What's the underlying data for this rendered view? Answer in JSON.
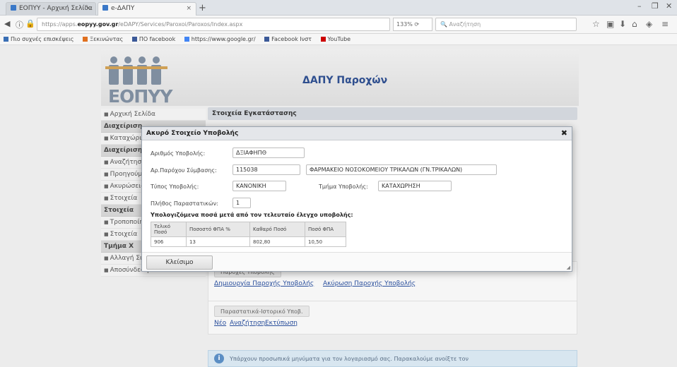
{
  "browser": {
    "tabs": [
      {
        "title": "ΕΟΠΥΥ - Αρχική Σελίδα"
      },
      {
        "title": "e-ΔΑΠΥ"
      }
    ],
    "address": {
      "prefix": "https://apps.",
      "domain": "eopyy.gov.gr",
      "path": "/eDAPY/Services/Paroxoi/Paroxos/Index.aspx"
    },
    "zoom": "133%",
    "search_placeholder": "Αναζήτηση",
    "bookmarks": [
      {
        "label": "Πιο συχνές επισκέψεις",
        "color": "#3a6fb5"
      },
      {
        "label": "Ξεκινώντας",
        "color": "#e07020"
      },
      {
        "label": "ΠΟ facebook",
        "color": "#3b5998"
      },
      {
        "label": "https://www.google.gr/",
        "color": "#4285f4"
      },
      {
        "label": "Facebook Ινστ",
        "color": "#3b5998"
      },
      {
        "label": "YouTube",
        "color": "#cc0000"
      }
    ]
  },
  "header": {
    "logo": "ΕΟΠΥΥ",
    "title": "ΔΑΠΥ Παροχών"
  },
  "sidebar": {
    "items": [
      {
        "kind": "item",
        "label": "Αρχική Σελίδα"
      },
      {
        "kind": "head",
        "label": "Διαχείριση"
      },
      {
        "kind": "item",
        "label": "Καταχώριση"
      },
      {
        "kind": "head",
        "label": "Διαχείριση"
      },
      {
        "kind": "item",
        "label": "Αναζήτηση"
      },
      {
        "kind": "item",
        "label": "Προηγούμενα"
      },
      {
        "kind": "item",
        "label": "Ακυρώσεις"
      },
      {
        "kind": "item",
        "label": "Στοιχεία"
      },
      {
        "kind": "head",
        "label": "Στοιχεία"
      },
      {
        "kind": "item",
        "label": "Τροποποίηση"
      },
      {
        "kind": "item",
        "label": "Στοιχεία"
      },
      {
        "kind": "head",
        "label": "Τμήμα Χ"
      },
      {
        "kind": "item",
        "label": "Αλλαγή Συνθηματικού"
      },
      {
        "kind": "item",
        "label": "Αποσύνδεση"
      }
    ]
  },
  "content": {
    "section_title": "Στοιχεία Εγκατάστασης",
    "pill_submissions": "Παροχές Υποβολής",
    "link_create": "Δημιουργία Παροχής Υποβολής",
    "link_cancel": "Ακύρωση Παροχής Υποβολής",
    "pill_history": "Παραστατικά-Ιστορικό Υποβ.",
    "link_new": "Νέο",
    "link_search": "Αναζήτηση",
    "link_print": "Εκτύπωση",
    "info_text": "Υπάρχουν προσωπικά μηνύματα για τον λογαριασμό σας. Παρακαλούμε ανοίξτε τον"
  },
  "modal": {
    "title": "Ακυρό Στοιχείο Υποβολής",
    "close_glyph": "✖",
    "fields": {
      "submission_no_label": "Αριθμός Υποβολής:",
      "submission_no": "ΔΞΙΑΦΗΠΘ",
      "provider_code_label": "Αρ.Παρόχου Σύμβασης:",
      "provider_code": "115038",
      "provider_name": "ΦΑΡΜΑΚΕΙΟ ΝΟΣΟΚΟΜΕΙΟΥ ΤΡΙΚΑΛΩΝ (ΓΝ.ΤΡΙΚΑΛΩΝ)",
      "type_label": "Τύπος Υποβολής:",
      "type": "ΚΑΝΟΝΙΚΗ",
      "category_label": "Τμήμα Υποβολής:",
      "category": "ΚΑΤΑΧΩΡΗΣΗ",
      "count_label": "Πλήθος Παραστατικών:",
      "count": "1"
    },
    "table_title": "Υπολογιζόμενα ποσά μετά από τον τελευταίο έλεγχο υποβολής:",
    "table_headers": [
      "Τελικό Ποσό",
      "Ποσοστό ΦΠΑ %",
      "Καθαρό Ποσό",
      "Ποσό ΦΠΑ"
    ],
    "table_rows": [
      [
        "906",
        "13",
        "802,80",
        "10,50"
      ]
    ],
    "close_button": "Κλείσιμο"
  }
}
